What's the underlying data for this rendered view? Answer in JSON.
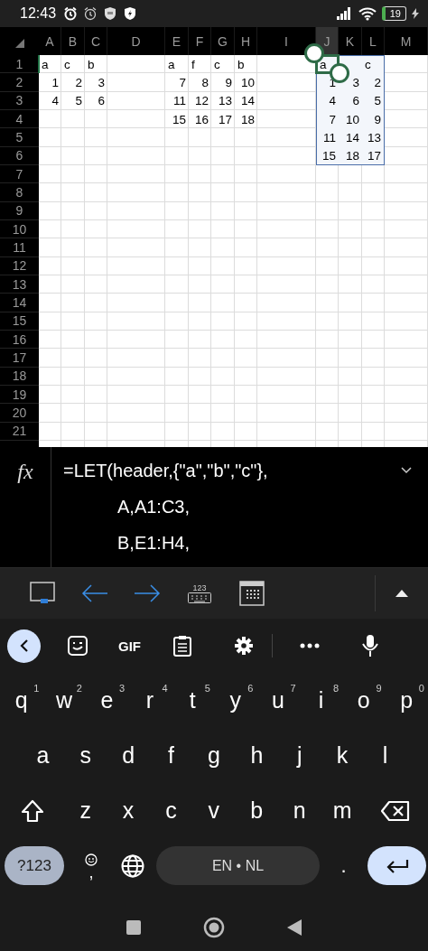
{
  "status_bar": {
    "time": "12:43",
    "battery": "19"
  },
  "sheet": {
    "columns": [
      {
        "label": "A",
        "selected": false
      },
      {
        "label": "B",
        "selected": false
      },
      {
        "label": "C",
        "selected": false
      },
      {
        "label": "D",
        "selected": false
      },
      {
        "label": "E",
        "selected": false
      },
      {
        "label": "F",
        "selected": false
      },
      {
        "label": "G",
        "selected": false
      },
      {
        "label": "H",
        "selected": false
      },
      {
        "label": "I",
        "selected": false
      },
      {
        "label": "J",
        "selected": true
      },
      {
        "label": "K",
        "selected": false
      },
      {
        "label": "L",
        "selected": false
      },
      {
        "label": "M",
        "selected": false
      }
    ],
    "rows": [
      {
        "label": "1",
        "active": true,
        "cells": [
          {
            "text": "a",
            "kind": "text",
            "in_range": false
          },
          {
            "text": "c",
            "kind": "text",
            "in_range": false
          },
          {
            "text": "b",
            "kind": "text",
            "in_range": false
          },
          null,
          {
            "text": "a",
            "kind": "text",
            "in_range": false
          },
          {
            "text": "f",
            "kind": "text",
            "in_range": false
          },
          {
            "text": "c",
            "kind": "text",
            "in_range": false
          },
          {
            "text": "b",
            "kind": "text",
            "in_range": false
          },
          null,
          {
            "text": "a",
            "kind": "text",
            "in_range": true
          },
          {
            "kind": "text",
            "in_range": true
          },
          {
            "text": "c",
            "kind": "text",
            "in_range": true
          }
        ]
      },
      {
        "label": "2",
        "active": false,
        "cells": [
          {
            "text": "1",
            "kind": "number",
            "in_range": false
          },
          {
            "text": "2",
            "kind": "number",
            "in_range": false
          },
          {
            "text": "3",
            "kind": "number",
            "in_range": false
          },
          null,
          {
            "text": "7",
            "kind": "number",
            "in_range": false
          },
          {
            "text": "8",
            "kind": "number",
            "in_range": false
          },
          {
            "text": "9",
            "kind": "number",
            "in_range": false
          },
          {
            "text": "10",
            "kind": "number",
            "in_range": false
          },
          null,
          {
            "text": "1",
            "kind": "number",
            "in_range": true
          },
          {
            "text": "3",
            "kind": "number",
            "in_range": true
          },
          {
            "text": "2",
            "kind": "number",
            "in_range": true
          }
        ]
      },
      {
        "label": "3",
        "active": false,
        "cells": [
          {
            "text": "4",
            "kind": "number",
            "in_range": false
          },
          {
            "text": "5",
            "kind": "number",
            "in_range": false
          },
          {
            "text": "6",
            "kind": "number",
            "in_range": false
          },
          null,
          {
            "text": "11",
            "kind": "number",
            "in_range": false
          },
          {
            "text": "12",
            "kind": "number",
            "in_range": false
          },
          {
            "text": "13",
            "kind": "number",
            "in_range": false
          },
          {
            "text": "14",
            "kind": "number",
            "in_range": false
          },
          null,
          {
            "text": "4",
            "kind": "number",
            "in_range": true
          },
          {
            "text": "6",
            "kind": "number",
            "in_range": true
          },
          {
            "text": "5",
            "kind": "number",
            "in_range": true
          }
        ]
      },
      {
        "label": "4",
        "active": false,
        "cells": [
          null,
          null,
          null,
          null,
          {
            "text": "15",
            "kind": "number",
            "in_range": false
          },
          {
            "text": "16",
            "kind": "number",
            "in_range": false
          },
          {
            "text": "17",
            "kind": "number",
            "in_range": false
          },
          {
            "text": "18",
            "kind": "number",
            "in_range": false
          },
          null,
          {
            "text": "7",
            "kind": "number",
            "in_range": true
          },
          {
            "text": "10",
            "kind": "number",
            "in_range": true
          },
          {
            "text": "9",
            "kind": "number",
            "in_range": true
          }
        ]
      },
      {
        "label": "5",
        "active": false,
        "cells": [
          null,
          null,
          null,
          null,
          null,
          null,
          null,
          null,
          null,
          {
            "text": "11",
            "kind": "number",
            "in_range": true
          },
          {
            "text": "14",
            "kind": "number",
            "in_range": true
          },
          {
            "text": "13",
            "kind": "number",
            "in_range": true
          }
        ]
      },
      {
        "label": "6",
        "active": false,
        "cells": [
          null,
          null,
          null,
          null,
          null,
          null,
          null,
          null,
          null,
          {
            "text": "15",
            "kind": "number",
            "in_range": true
          },
          {
            "text": "18",
            "kind": "number",
            "in_range": true
          },
          {
            "text": "17",
            "kind": "number",
            "in_range": true
          }
        ]
      },
      {
        "label": "7",
        "active": false
      },
      {
        "label": "8",
        "active": false
      },
      {
        "label": "9",
        "active": false
      },
      {
        "label": "10",
        "active": false
      },
      {
        "label": "11",
        "active": false
      },
      {
        "label": "12",
        "active": false
      },
      {
        "label": "13",
        "active": false
      },
      {
        "label": "14",
        "active": false
      },
      {
        "label": "15",
        "active": false
      },
      {
        "label": "16",
        "active": false
      },
      {
        "label": "17",
        "active": false
      },
      {
        "label": "18",
        "active": false
      },
      {
        "label": "19",
        "active": false
      },
      {
        "label": "20",
        "active": false
      },
      {
        "label": "21",
        "active": false
      }
    ]
  },
  "formula_bar": {
    "label": "fx",
    "lines": [
      "=LET(header,{\"a\",\"b\",\"c\"},",
      "A,A1:C3,",
      "B,E1:H4,"
    ]
  },
  "toolbar": {
    "keypad_label": "123"
  },
  "keyboard": {
    "gif": "GIF",
    "row1": [
      {
        "key": "q",
        "hint": "1"
      },
      {
        "key": "w",
        "hint": "2"
      },
      {
        "key": "e",
        "hint": "3"
      },
      {
        "key": "r",
        "hint": "4"
      },
      {
        "key": "t",
        "hint": "5"
      },
      {
        "key": "y",
        "hint": "6"
      },
      {
        "key": "u",
        "hint": "7"
      },
      {
        "key": "i",
        "hint": "8"
      },
      {
        "key": "o",
        "hint": "9"
      },
      {
        "key": "p",
        "hint": "0"
      }
    ],
    "row2": [
      "a",
      "s",
      "d",
      "f",
      "g",
      "h",
      "j",
      "k",
      "l"
    ],
    "row3": [
      "z",
      "x",
      "c",
      "v",
      "b",
      "n",
      "m"
    ],
    "symbols": "?123",
    "comma": ",",
    "space": "EN • NL",
    "period": "."
  }
}
